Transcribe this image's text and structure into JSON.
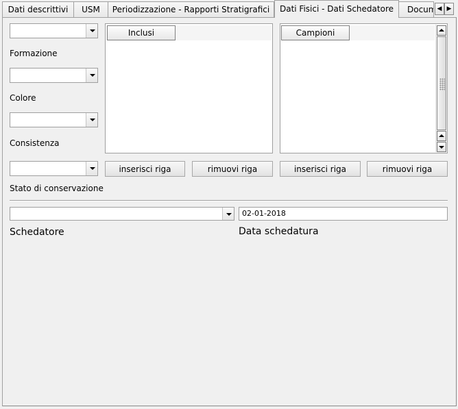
{
  "tabs": [
    {
      "label": "Dati descrittivi"
    },
    {
      "label": "USM"
    },
    {
      "label": "Periodizzazione - Rapporti Stratigrafici"
    },
    {
      "label": "Dati Fisici - Dati Schedatore"
    },
    {
      "label": "Documentazione"
    }
  ],
  "fields": {
    "formazione_label": "Formazione",
    "colore_label": "Colore",
    "consistenza_label": "Consistenza",
    "stato_label": "Stato di conservazione",
    "schedatore_label": "Schedatore",
    "data_label": "Data schedatura",
    "data_value": "02-01-2018"
  },
  "inclusi": {
    "header": "Inclusi",
    "add_label": "inserisci riga",
    "remove_label": "rimuovi riga"
  },
  "campioni": {
    "header": "Campioni",
    "add_label": "inserisci riga",
    "remove_label": "rimuovi riga"
  }
}
